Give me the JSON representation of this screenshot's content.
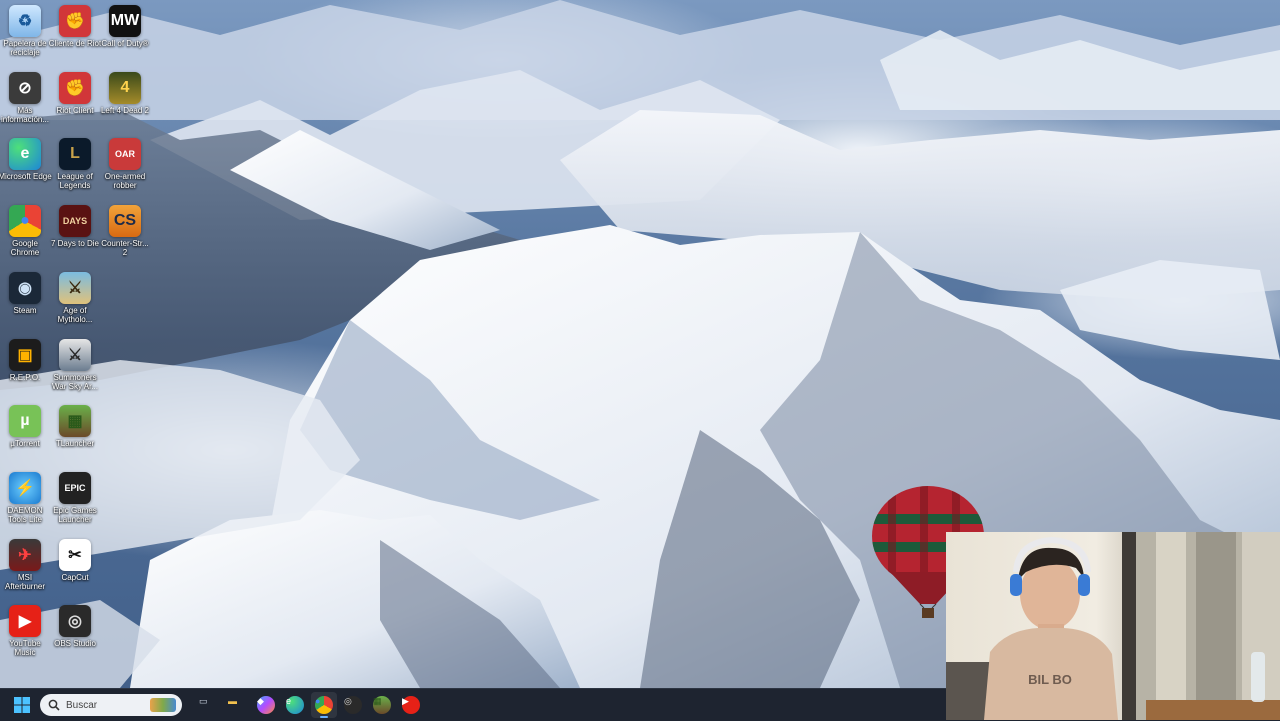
{
  "desktop": {
    "icons": [
      {
        "label": "Papelera de reciclaje",
        "icon": "recycle-bin-icon"
      },
      {
        "label": "Cliente de Riot",
        "icon": "riot-client-icon"
      },
      {
        "label": "Call of Duty®",
        "icon": "call-of-duty-icon"
      },
      {
        "label": "Más información...",
        "icon": "info-icon"
      },
      {
        "label": "Riot Client",
        "icon": "riot-client-icon"
      },
      {
        "label": "Left 4 Dead 2",
        "icon": "left4dead2-icon"
      },
      {
        "label": "Microsoft Edge",
        "icon": "edge-icon"
      },
      {
        "label": "League of Legends",
        "icon": "league-of-legends-icon"
      },
      {
        "label": "One-armed robber",
        "icon": "one-armed-robber-icon"
      },
      {
        "label": "Google Chrome",
        "icon": "chrome-icon"
      },
      {
        "label": "7 Days to Die",
        "icon": "seven-days-to-die-icon"
      },
      {
        "label": "Counter-Str... 2",
        "icon": "counter-strike-icon"
      },
      {
        "label": "Steam",
        "icon": "steam-icon"
      },
      {
        "label": "Age of Mytholo...",
        "icon": "age-of-mythology-icon"
      },
      {
        "label": "R.E.P.O.",
        "icon": "repo-icon"
      },
      {
        "label": "Summoners War Sky Ar...",
        "icon": "summoners-war-icon"
      },
      {
        "label": "µTorrent",
        "icon": "utorrent-icon"
      },
      {
        "label": "TLauncher",
        "icon": "tlauncher-icon"
      },
      {
        "label": "DAEMON Tools Lite",
        "icon": "daemon-tools-icon"
      },
      {
        "label": "Epic Games Launcher",
        "icon": "epic-games-icon"
      },
      {
        "label": "MSI Afterburner",
        "icon": "msi-afterburner-icon"
      },
      {
        "label": "CapCut",
        "icon": "capcut-icon"
      },
      {
        "label": "YouTube Music",
        "icon": "youtube-music-icon"
      },
      {
        "label": "OBS Studio",
        "icon": "obs-studio-icon"
      }
    ],
    "icon_badges": {
      "epic": "EPIC\nGAMES",
      "mw": "MW",
      "days": "DAYS",
      "oar": "OAR"
    }
  },
  "taskbar": {
    "search_placeholder": "Buscar",
    "apps": [
      {
        "name": "task-view",
        "icon": "task-view-icon"
      },
      {
        "name": "file-explorer",
        "icon": "folder-icon"
      },
      {
        "name": "copilot",
        "icon": "copilot-icon"
      },
      {
        "name": "edge",
        "icon": "edge-icon"
      },
      {
        "name": "chrome",
        "icon": "chrome-icon",
        "active": true
      },
      {
        "name": "obs",
        "icon": "obs-studio-icon"
      },
      {
        "name": "tlauncher",
        "icon": "tlauncher-icon"
      },
      {
        "name": "youtube-music",
        "icon": "youtube-music-icon"
      }
    ]
  },
  "webcam": {
    "shirt_text": "BIL BO"
  },
  "colors": {
    "taskbar_bg": "#1e2430",
    "accent": "#6cb4ff",
    "riot_red": "#d13639",
    "youtube_red": "#e62117",
    "steam_blue": "#1b2838"
  }
}
